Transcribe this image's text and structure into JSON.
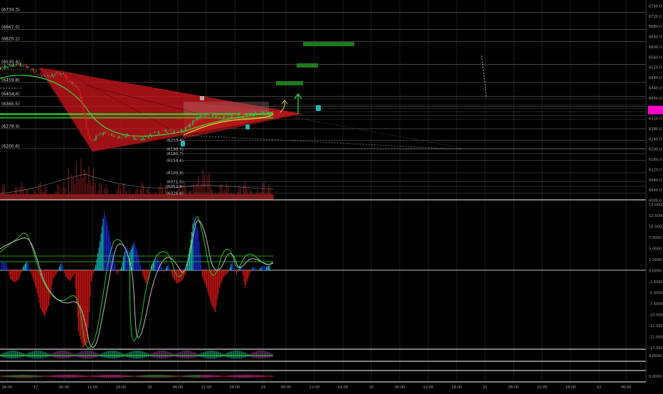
{
  "colors": {
    "background": "#000000",
    "grid": "#1b1b1b",
    "level_line": "#5a5a5a",
    "axis_text": "#9b9b9b",
    "pattern_fill": "#c0151b",
    "pattern_line": "#8a0c10",
    "candle_up": "#1fbf5a",
    "candle_down": "#d42020",
    "ma_green": "#33dd33",
    "ma_yellow": "#d8d83a",
    "target_box": "#1f7a1f",
    "target_cyan": "#1fb5b5",
    "volume": "#8b1e1e",
    "hist_cyan": "#12b5c4",
    "hist_blue": "#1726c8",
    "hist_red": "#d01515",
    "osc_green": "#2ec22e",
    "osc_white": "#bcbcbc",
    "price_tag": "#ff00c8",
    "panel_separator": "#ffffff"
  },
  "chart_data": [
    {
      "type": "line",
      "panel": "price",
      "y_axis_ticks": [
        "6760.0",
        "6720.0",
        "6680.0",
        "6640.0",
        "6600.0",
        "6560.0",
        "6520.0",
        "6480.0",
        "6440.0",
        "6400.0",
        "6360.0",
        "6320.0",
        "6280.0",
        "6240.0",
        "6200.0",
        "6160.0",
        "6120.0",
        "6080.0",
        "6040.0",
        "6000.0"
      ],
      "ylim": [
        5990,
        6790
      ],
      "x_axis_ticks": [
        "16:00",
        "17",
        "06:00",
        "12:00",
        "18:00",
        "18",
        "06:00",
        "12:00",
        "18:00",
        "19",
        "06:00",
        "12:00",
        "18:00",
        "20",
        "06:00",
        "12:00",
        "18:00",
        "21",
        "06:00",
        "12:00",
        "18:00",
        "22",
        "06:00"
      ],
      "level_labels": [
        {
          "text": "(6734.3)",
          "value": 6734.3
        },
        {
          "text": "(6667.0)",
          "value": 6667.0
        },
        {
          "text": "(6620.2)",
          "value": 6620.2
        },
        {
          "text": "(6530.4)",
          "value": 6530.4
        },
        {
          "text": "(6459.8)",
          "value": 6459.8
        },
        {
          "text": "(6404.4)",
          "value": 6404.4
        },
        {
          "text": "(6365.5)",
          "value": 6365.5
        },
        {
          "text": "(6278.4)",
          "value": 6278.4
        },
        {
          "text": "(6200.6)",
          "value": 6200.6
        }
      ],
      "inner_level_labels": [
        {
          "text": "(6233.4)",
          "value": 6233.4
        },
        {
          "text": "(6198.9)",
          "value": 6198.9
        },
        {
          "text": "(6180.7)",
          "value": 6180.7
        },
        {
          "text": "(6154.6)",
          "value": 6154.6
        },
        {
          "text": "(6105.8)",
          "value": 6105.8
        },
        {
          "text": "(6071.0)",
          "value": 6071.0
        },
        {
          "text": "(6052.9)",
          "value": 6052.9
        },
        {
          "text": "(6026.8)",
          "value": 6026.8
        }
      ],
      "series": [
        {
          "name": "",
          "x": [
            0,
            10,
            20,
            30,
            40,
            50,
            60,
            70,
            80,
            90,
            100,
            110,
            116,
            120,
            125,
            130,
            140,
            150,
            160,
            170,
            180,
            190,
            200,
            210,
            220,
            230,
            240,
            250,
            260,
            270,
            280,
            290,
            300,
            310,
            320,
            330,
            340,
            350,
            360,
            370,
            380
          ],
          "values": [
            6515,
            6522,
            6528,
            6530,
            6520,
            6500,
            6485,
            6480,
            6495,
            6490,
            6460,
            6440,
            6380,
            6320,
            6250,
            6230,
            6255,
            6265,
            6250,
            6245,
            6252,
            6240,
            6238,
            6250,
            6262,
            6268,
            6270,
            6265,
            6275,
            6300,
            6325,
            6335,
            6330,
            6320,
            6325,
            6330,
            6335,
            6328,
            6338,
            6342,
            6345
          ]
        }
      ]
    },
    {
      "type": "bar",
      "panel": "oscillator",
      "y_axis_ticks": [
        "15.0000",
        "12.5000",
        "10.0000",
        "7.5000",
        "5.0000",
        "2.5000",
        "0.0000",
        "-2.5000",
        "-5.0000",
        "-7.5000",
        "-10.0000",
        "-12.5000",
        "-15.0000",
        "-17.5000"
      ],
      "ylim": [
        -18.5,
        15.5
      ],
      "x": [
        2,
        8,
        14,
        20,
        26,
        32,
        38,
        44,
        50,
        56,
        62,
        68,
        74,
        80,
        86,
        92,
        98,
        104,
        110,
        116,
        122,
        128,
        134,
        140,
        146,
        152,
        158,
        164,
        170,
        176,
        182,
        188,
        194,
        200,
        206,
        212,
        218,
        224,
        230,
        236,
        242,
        248,
        254,
        260,
        266,
        272,
        278,
        284,
        290,
        296,
        302,
        308,
        314,
        320,
        326,
        332,
        338,
        344,
        350,
        356,
        362,
        368,
        374,
        380
      ],
      "values": [
        2.2,
        1.6,
        -2.0,
        -2.8,
        -2.0,
        0.8,
        2.2,
        -1.0,
        -4.0,
        -8.5,
        -10.5,
        -8.0,
        -2.0,
        -0.5,
        2.0,
        -1.5,
        -2.5,
        -0.8,
        -14.0,
        -17.5,
        -16.5,
        -2.5,
        1.2,
        6.5,
        13.5,
        9.0,
        4.0,
        -1.0,
        0.6,
        5.5,
        4.0,
        6.5,
        3.5,
        -1.2,
        -3.5,
        1.0,
        3.0,
        2.0,
        -0.5,
        1.5,
        -1.5,
        -3.0,
        -2.5,
        -1.0,
        5.0,
        12.5,
        9.0,
        -1.5,
        -4.0,
        -7.5,
        -9.5,
        -4.0,
        -1.5,
        -0.5,
        2.0,
        -1.0,
        1.5,
        -4.0,
        -1.0,
        1.0,
        -0.2,
        1.0,
        0.8,
        1.2
      ]
    }
  ],
  "price_tag": {
    "value": 6365.5
  }
}
